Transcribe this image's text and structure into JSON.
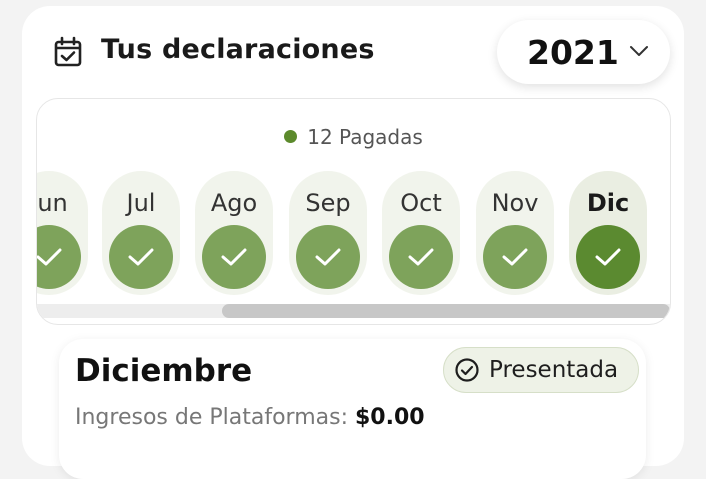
{
  "header": {
    "title": "Tus declaraciones",
    "calendar_icon": "calendar-check-icon",
    "year": "2021",
    "year_chevron_icon": "chevron-down-icon"
  },
  "summary": {
    "paid_label": "12 Pagadas",
    "paid_color": "#5c8a2c"
  },
  "months": [
    {
      "label": "Jun",
      "status": "paid",
      "icon": "check-icon"
    },
    {
      "label": "Jul",
      "status": "paid",
      "icon": "check-icon"
    },
    {
      "label": "Ago",
      "status": "paid",
      "icon": "check-icon"
    },
    {
      "label": "Sep",
      "status": "paid",
      "icon": "check-icon"
    },
    {
      "label": "Oct",
      "status": "paid",
      "icon": "check-icon"
    },
    {
      "label": "Nov",
      "status": "paid",
      "icon": "check-icon"
    },
    {
      "label": "Dic",
      "status": "paid",
      "icon": "check-icon",
      "selected": true
    }
  ],
  "detail": {
    "title": "Diciembre",
    "status_badge": "Presentada",
    "status_icon": "check-circle-icon",
    "income_label": "Ingresos de Plataformas:",
    "income_value": "$0.00"
  },
  "colors": {
    "accent": "#5b8a30",
    "check_bg": "#7ea35b",
    "month_bg": "#f1f4ec"
  }
}
